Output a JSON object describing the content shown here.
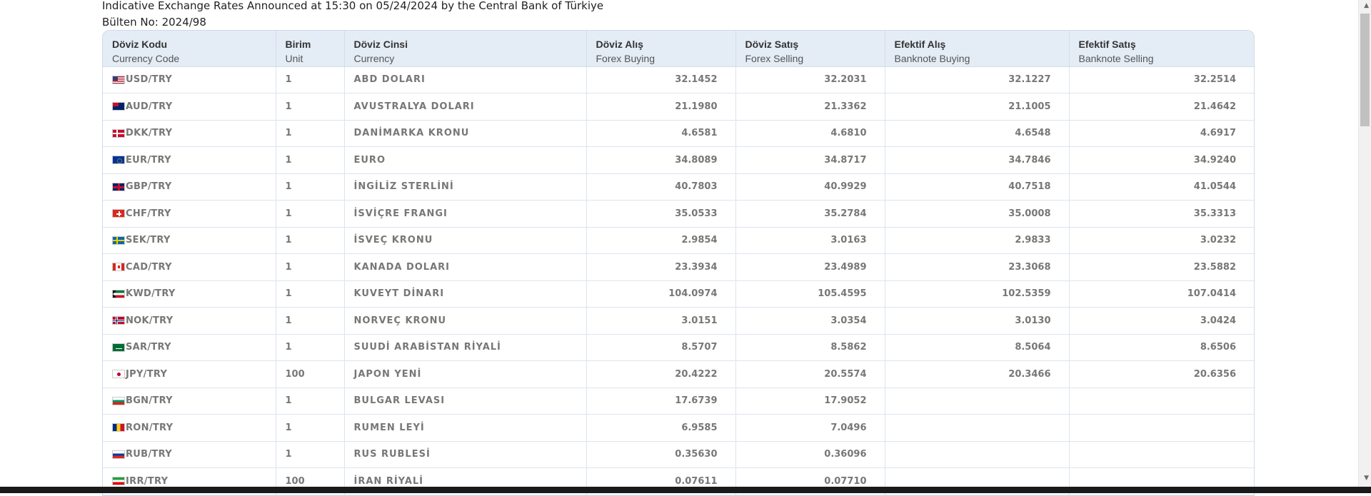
{
  "intro": {
    "line1": "Indicative Exchange Rates Announced at 15:30 on 05/24/2024 by the Central Bank of Türkiye",
    "line2": "Bülten No: 2024/98"
  },
  "table": {
    "headers": [
      {
        "tr": "Döviz Kodu",
        "en": "Currency Code"
      },
      {
        "tr": "Birim",
        "en": "Unit"
      },
      {
        "tr": "Döviz Cinsi",
        "en": "Currency"
      },
      {
        "tr": "Döviz Alış",
        "en": "Forex Buying"
      },
      {
        "tr": "Döviz Satış",
        "en": "Forex Selling"
      },
      {
        "tr": "Efektif Alış",
        "en": "Banknote Buying"
      },
      {
        "tr": "Efektif Satış",
        "en": "Banknote Selling"
      }
    ],
    "rows": [
      {
        "flag": "us-flag-icon",
        "code": "USD/TRY",
        "unit": "1",
        "name": "ABD DOLARI",
        "fb": "32.1452",
        "fs": "32.2031",
        "bb": "32.1227",
        "bs": "32.2514"
      },
      {
        "flag": "au-flag-icon",
        "code": "AUD/TRY",
        "unit": "1",
        "name": "AVUSTRALYA DOLARI",
        "fb": "21.1980",
        "fs": "21.3362",
        "bb": "21.1005",
        "bs": "21.4642"
      },
      {
        "flag": "dk-flag-icon",
        "code": "DKK/TRY",
        "unit": "1",
        "name": "DANİMARKA KRONU",
        "fb": "4.6581",
        "fs": "4.6810",
        "bb": "4.6548",
        "bs": "4.6917"
      },
      {
        "flag": "eu-flag-icon",
        "code": "EUR/TRY",
        "unit": "1",
        "name": "EURO",
        "fb": "34.8089",
        "fs": "34.8717",
        "bb": "34.7846",
        "bs": "34.9240"
      },
      {
        "flag": "gb-flag-icon",
        "code": "GBP/TRY",
        "unit": "1",
        "name": "İNGİLİZ STERLİNİ",
        "fb": "40.7803",
        "fs": "40.9929",
        "bb": "40.7518",
        "bs": "41.0544"
      },
      {
        "flag": "ch-flag-icon",
        "code": "CHF/TRY",
        "unit": "1",
        "name": "İSVİÇRE FRANGI",
        "fb": "35.0533",
        "fs": "35.2784",
        "bb": "35.0008",
        "bs": "35.3313"
      },
      {
        "flag": "se-flag-icon",
        "code": "SEK/TRY",
        "unit": "1",
        "name": "İSVEÇ KRONU",
        "fb": "2.9854",
        "fs": "3.0163",
        "bb": "2.9833",
        "bs": "3.0232"
      },
      {
        "flag": "ca-flag-icon",
        "code": "CAD/TRY",
        "unit": "1",
        "name": "KANADA DOLARI",
        "fb": "23.3934",
        "fs": "23.4989",
        "bb": "23.3068",
        "bs": "23.5882"
      },
      {
        "flag": "kw-flag-icon",
        "code": "KWD/TRY",
        "unit": "1",
        "name": "KUVEYT DİNARI",
        "fb": "104.0974",
        "fs": "105.4595",
        "bb": "102.5359",
        "bs": "107.0414"
      },
      {
        "flag": "no-flag-icon",
        "code": "NOK/TRY",
        "unit": "1",
        "name": "NORVEÇ KRONU",
        "fb": "3.0151",
        "fs": "3.0354",
        "bb": "3.0130",
        "bs": "3.0424"
      },
      {
        "flag": "sa-flag-icon",
        "code": "SAR/TRY",
        "unit": "1",
        "name": "SUUDİ ARABİSTAN RİYALİ",
        "fb": "8.5707",
        "fs": "8.5862",
        "bb": "8.5064",
        "bs": "8.6506"
      },
      {
        "flag": "jp-flag-icon",
        "code": "JPY/TRY",
        "unit": "100",
        "name": "JAPON YENİ",
        "fb": "20.4222",
        "fs": "20.5574",
        "bb": "20.3466",
        "bs": "20.6356"
      },
      {
        "flag": "bg-flag-icon",
        "code": "BGN/TRY",
        "unit": "1",
        "name": "BULGAR LEVASI",
        "fb": "17.6739",
        "fs": "17.9052",
        "bb": "",
        "bs": ""
      },
      {
        "flag": "ro-flag-icon",
        "code": "RON/TRY",
        "unit": "1",
        "name": "RUMEN LEYİ",
        "fb": "6.9585",
        "fs": "7.0496",
        "bb": "",
        "bs": ""
      },
      {
        "flag": "ru-flag-icon",
        "code": "RUB/TRY",
        "unit": "1",
        "name": "RUS RUBLESİ",
        "fb": "0.35630",
        "fs": "0.36096",
        "bb": "",
        "bs": ""
      },
      {
        "flag": "ir-flag-icon",
        "code": "IRR/TRY",
        "unit": "100",
        "name": "İRAN RİYALİ",
        "fb": "0.07611",
        "fs": "0.07710",
        "bb": "",
        "bs": ""
      }
    ]
  },
  "colors": {
    "header_bg": "#e4ecf6",
    "border": "#dde4ee",
    "cell_text": "#777777"
  }
}
